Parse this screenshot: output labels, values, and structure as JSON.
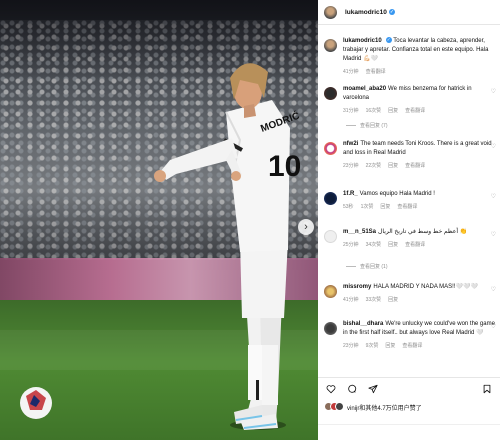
{
  "post": {
    "username": "lukamodric10",
    "caption_text": "Toca levantar la cabeza, aprender, trabajar y apretar. Confianza total en este equipo. Hala Madrid 💪🏻🤍",
    "caption_time": "41分钟",
    "caption_translate": "查看翻译"
  },
  "comments": [
    {
      "user": "moamel_aba20",
      "text": "We miss benzema for hatrick in varcelona",
      "time": "31分钟",
      "likes": "16次赞",
      "reply": "回复",
      "translate": "查看翻译",
      "replies": "查看回复 (7)"
    },
    {
      "user": "nfw2i",
      "text": "The team needs Toni Kroos. There is a great void and loss in Real Madrid",
      "time": "23分钟",
      "likes": "22次赞",
      "reply": "回复",
      "translate": "查看翻译"
    },
    {
      "user": "1f.R_",
      "text": "Vamos equipo Hala Madrid !",
      "time": "53秒",
      "likes": "1次赞",
      "reply": "回复",
      "translate": "查看翻译"
    },
    {
      "user": "m__n_51Sa",
      "text": "أعظم خط وسط في تاريخ الريال 👏",
      "time": "25分钟",
      "likes": "34次赞",
      "reply": "回复",
      "translate": "查看翻译",
      "replies": "查看回复 (1)"
    },
    {
      "user": "missromy",
      "text": "HALA MADRID Y NADA MAS!!🤍🤍🤍",
      "time": "41分钟",
      "likes": "33次赞",
      "reply": "回复"
    },
    {
      "user": "bishal__dhara",
      "text": "We're unlucky we could've won the game in the first half itself.. but always love Real Madrid 🤍",
      "time": "23分钟",
      "likes": "9次赞",
      "reply": "回复",
      "translate": "查看翻译"
    }
  ],
  "likes_line": "vinijr和其他4.7万位用户赞了",
  "jersey_text": "MODRIĆ",
  "jersey_number": "10",
  "colors": {
    "verified": "#3897f0",
    "meta": "#8e8e8e",
    "pitch": "#4f8a33"
  }
}
